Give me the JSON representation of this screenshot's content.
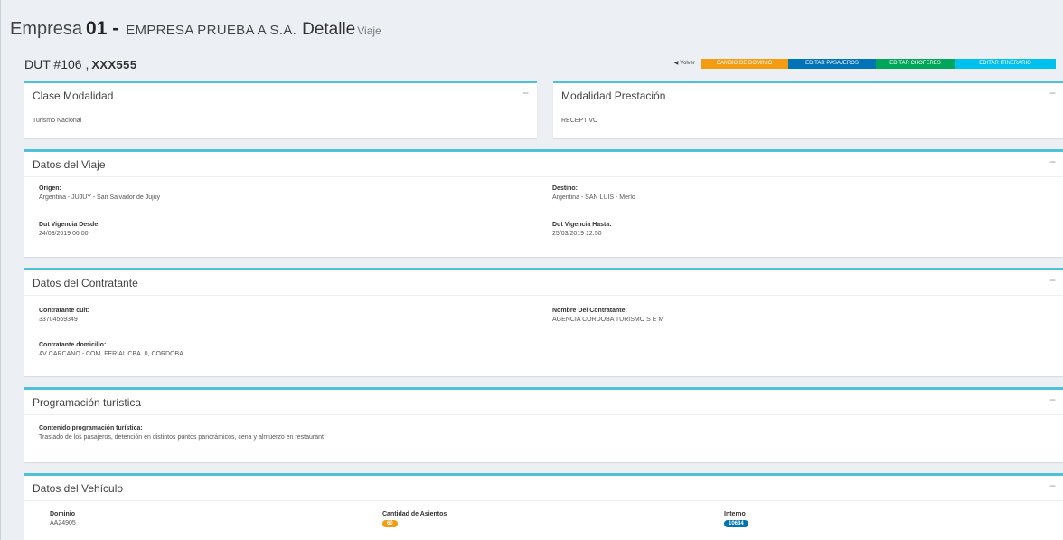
{
  "header": {
    "company_label": "Empresa",
    "company_number": "01 -",
    "company_name": "EMPRESA PRUEBA A S.A.",
    "detail_label": "Detalle",
    "detail_sub": "Viaje"
  },
  "subheader": {
    "dut_label": "DUT #106 ,",
    "dut_code": "XXX555"
  },
  "toolbar": {
    "back_label": "Volver",
    "btn1_label": "CAMBIO DE DOMINIO",
    "btn2_label": "EDITAR PASAJEROS",
    "btn3_label": "EDITAR CHOFERES",
    "btn4_label": "EDITAR ITINERARIO"
  },
  "clase_modalidad": {
    "title": "Clase Modalidad",
    "value": "Turismo Nacional"
  },
  "modalidad_prestacion": {
    "title": "Modalidad Prestación",
    "value": "RECEPTIVO"
  },
  "datos_viaje": {
    "title": "Datos del Viaje",
    "origen_label": "Origen:",
    "origen_value": "Argentina - JUJUY - San Salvador de Jujuy",
    "destino_label": "Destino:",
    "destino_value": "Argentina - SAN LUIS - Merlo",
    "desde_label": "Dut Vigencia Desde:",
    "desde_value": "24/03/2019 06:00",
    "hasta_label": "Dut Vigencia Hasta:",
    "hasta_value": "25/03/2019 12:50"
  },
  "datos_contratante": {
    "title": "Datos del Contratante",
    "cuit_label": "Contratante cuit:",
    "cuit_value": "33704569349",
    "nombre_label": "Nombre Del Contratante:",
    "nombre_value": "AGENCIA CORDOBA TURISMO S E M",
    "domicilio_label": "Contratante domicilio:",
    "domicilio_value": "AV CARCANO - COM. FERIAL CBA. 0, CORDOBA"
  },
  "programacion": {
    "title": "Programación turística",
    "contenido_label": "Contenido programación turística:",
    "contenido_value": "Traslado de los pasajeros, detención en distintos puntos panorámicos, cena y almuerzo en restaurant"
  },
  "datos_vehiculo": {
    "title": "Datos del Vehículo",
    "dominio_label": "Dominio",
    "dominio_value": "AA24905",
    "asientos_label": "Cantidad de Asientos",
    "asientos_value": "60",
    "interno_label": "Interno",
    "interno_value": "10634"
  },
  "collapse_symbol": "−",
  "colors": {
    "box_border": "#4fc0da",
    "orange": "#f39c12",
    "blue": "#0073b7",
    "green": "#00a65a",
    "aqua": "#00c0ef"
  }
}
